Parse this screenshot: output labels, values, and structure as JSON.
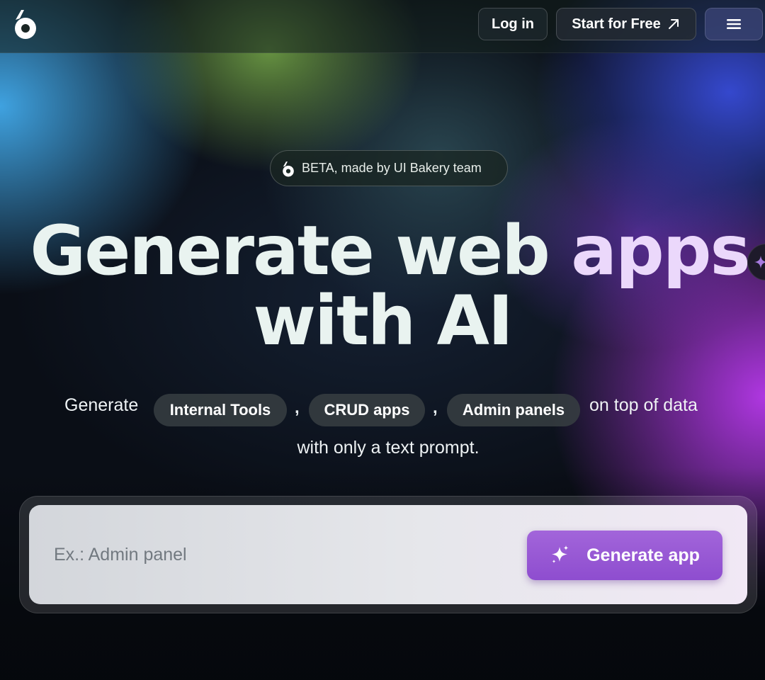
{
  "header": {
    "logo_icon": "ui-bakery-logo-icon",
    "login_label": "Log in",
    "start_label": "Start for Free",
    "start_icon": "arrow-up-right-icon",
    "menu_icon": "hamburger-menu-icon"
  },
  "hero": {
    "badge_label": "BETA, made by UI Bakery team",
    "title_line1_white": "Generate web",
    "title_line1_accent": "apps",
    "title_line2": "with AI",
    "sub_prefix": "Generate",
    "chips": [
      "Internal Tools",
      "CRUD apps",
      "Admin panels"
    ],
    "separator": ",",
    "sub_suffix": "on top of data",
    "sub_line2": "with only a text prompt."
  },
  "prompt": {
    "placeholder": "Ex.: Admin panel",
    "value": "",
    "button_label": "Generate app",
    "button_icon": "sparkle-icon"
  },
  "colors": {
    "accent_purple": "#9b5ad8",
    "title_white": "#e9f3f0",
    "title_purple": "#ebd8fb"
  }
}
